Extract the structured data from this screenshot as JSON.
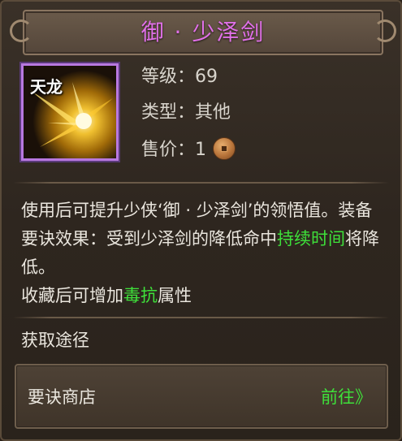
{
  "title": "御 · 少泽剑",
  "item": {
    "icon_label": "天龙",
    "icon_name": "sword-qi-icon"
  },
  "stats": {
    "level_label": "等级：",
    "level_value": "69",
    "type_label": "类型：",
    "type_value": "其他",
    "price_label": "售价：",
    "price_value": "1",
    "price_icon": "copper-coin-icon"
  },
  "description": {
    "part1": "使用后可提升少侠‘御 · 少泽剑’的领悟值。装备要诀效果：受到少泽剑的降低命中",
    "highlight1": "持续时间",
    "part2": "将降低。",
    "part3": "收藏后可增加",
    "highlight2": "毒抗",
    "part4": "属性"
  },
  "source": {
    "section_title": "获取途径",
    "items": [
      {
        "name": "要诀商店",
        "action": "前往》"
      }
    ]
  },
  "colors": {
    "title": "#e070e8",
    "highlight": "#3ee03a",
    "icon_border": "#b878e0"
  }
}
